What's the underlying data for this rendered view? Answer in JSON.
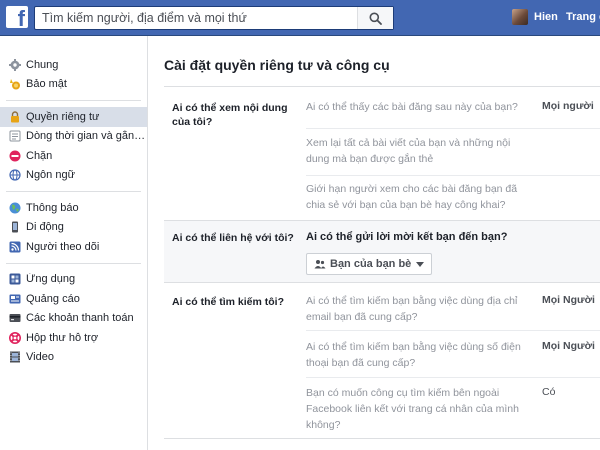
{
  "header": {
    "logo": "f",
    "search_placeholder": "Tìm kiếm người, địa điểm và mọi thứ",
    "user_name": "Hien",
    "home_label": "Trang chủ"
  },
  "sidebar": {
    "groups": [
      [
        {
          "label": "Chung",
          "icon": "gear-icon"
        },
        {
          "label": "Bảo mật",
          "icon": "badge-icon"
        }
      ],
      [
        {
          "label": "Quyền riêng tư",
          "icon": "lock-icon",
          "active": true
        },
        {
          "label": "Dòng thời gian và gắn t...",
          "icon": "timeline-icon"
        },
        {
          "label": "Chặn",
          "icon": "block-icon"
        },
        {
          "label": "Ngôn ngữ",
          "icon": "globe-icon"
        }
      ],
      [
        {
          "label": "Thông báo",
          "icon": "earth-icon"
        },
        {
          "label": "Di động",
          "icon": "mobile-icon"
        },
        {
          "label": "Người theo dõi",
          "icon": "rss-icon"
        }
      ],
      [
        {
          "label": "Ứng dụng",
          "icon": "apps-icon"
        },
        {
          "label": "Quảng cáo",
          "icon": "ads-icon"
        },
        {
          "label": "Các khoản thanh toán",
          "icon": "card-icon"
        },
        {
          "label": "Hộp thư hỗ trợ",
          "icon": "lifebuoy-icon"
        },
        {
          "label": "Video",
          "icon": "film-icon"
        }
      ]
    ]
  },
  "main": {
    "title": "Cài đặt quyền riêng tư và công cụ",
    "sections": [
      {
        "label": "Ai có thể xem nội dung của tôi?",
        "rows": [
          {
            "question": "Ai có thể thấy các bài đăng sau này của bạn?",
            "value": "Mọi người"
          },
          {
            "question": "Xem lại tất cả bài viết của bạn và những nội dung mà bạn được gắn thẻ",
            "value": ""
          },
          {
            "question": "Giới hạn người xem cho các bài đăng bạn đã chia sẻ với bạn của bạn bè hay công khai?",
            "value": ""
          }
        ]
      },
      {
        "label": "Ai có thể liên hệ với tôi?",
        "expanded": true,
        "question": "Ai có thể gửi lời mời kết bạn đến bạn?",
        "dropdown": "Bạn của bạn bè"
      },
      {
        "label": "Ai có thể tìm kiếm tôi?",
        "rows": [
          {
            "question": "Ai có thể tìm kiếm bạn bằng việc dùng địa chỉ email bạn đã cung cấp?",
            "value": "Mọi Người"
          },
          {
            "question": "Ai có thể tìm kiếm bạn bằng việc dùng số điện thoại bạn đã cung cấp?",
            "value": "Mọi Người"
          },
          {
            "question": "Bạn có muốn công cụ tìm kiếm bên ngoài Facebook liên kết với trang cá nhân của mình không?",
            "value": "Có"
          }
        ]
      }
    ]
  },
  "colors": {
    "brand": "#4267b2",
    "active_nav": "#d8dee8",
    "muted_text": "#90949c"
  }
}
